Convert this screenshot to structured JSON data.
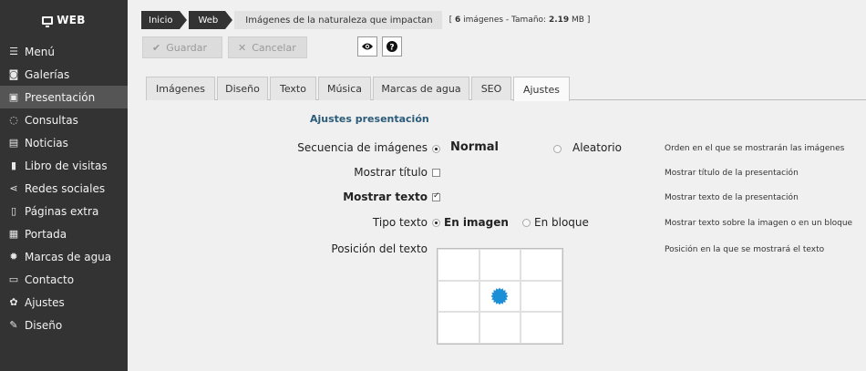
{
  "sidebar": {
    "brand": "WEB",
    "items": [
      {
        "label": "Menú",
        "icon": "menu-icon"
      },
      {
        "label": "Galerías",
        "icon": "camera-icon"
      },
      {
        "label": "Presentación",
        "icon": "image-icon",
        "active": true
      },
      {
        "label": "Consultas",
        "icon": "chat-icon"
      },
      {
        "label": "Noticias",
        "icon": "newspaper-icon"
      },
      {
        "label": "Libro de visitas",
        "icon": "book-icon"
      },
      {
        "label": "Redes sociales",
        "icon": "share-icon"
      },
      {
        "label": "Páginas extra",
        "icon": "file-icon"
      },
      {
        "label": "Portada",
        "icon": "grid-icon"
      },
      {
        "label": "Marcas de agua",
        "icon": "badge-icon"
      },
      {
        "label": "Contacto",
        "icon": "contact-card-icon"
      },
      {
        "label": "Ajustes",
        "icon": "gear-icon"
      },
      {
        "label": "Diseño",
        "icon": "brush-icon"
      }
    ]
  },
  "breadcrumb": [
    "Inicio",
    "Web",
    "Imágenes de la naturaleza que impactan"
  ],
  "info": {
    "prefix": "[ ",
    "count": "6",
    "count_suffix": " imágenes - Tamaño: ",
    "size": "2.19",
    "size_suffix": " MB ]"
  },
  "toolbar": {
    "save_label": "Guardar",
    "cancel_label": "Cancelar"
  },
  "tabs": [
    "Imágenes",
    "Diseño",
    "Texto",
    "Música",
    "Marcas de agua",
    "SEO",
    "Ajustes"
  ],
  "active_tab": "Ajustes",
  "section_title": "Ajustes presentación",
  "settings": {
    "sequence": {
      "label": "Secuencia de imágenes",
      "opt1": "Normal",
      "opt2": "Aleatorio",
      "help": "Orden en el que se mostrarán las imágenes",
      "selected": "Normal"
    },
    "show_title": {
      "label": "Mostrar título",
      "help": "Mostrar título de la presentación",
      "checked": false
    },
    "show_text": {
      "label": "Mostrar texto",
      "help": "Mostrar texto de la presentación",
      "checked": true
    },
    "text_type": {
      "label": "Tipo texto",
      "opt1": "En imagen",
      "opt2": "En bloque",
      "help": "Mostrar texto sobre la imagen o en un bloque",
      "selected": "En imagen"
    },
    "text_position": {
      "label": "Posición del texto",
      "help": "Posición en la que se mostrará el texto",
      "selected_cell": "center"
    }
  },
  "colors": {
    "accent": "#1a8fd6",
    "sidebar": "#333333",
    "title": "#2a5b78"
  }
}
